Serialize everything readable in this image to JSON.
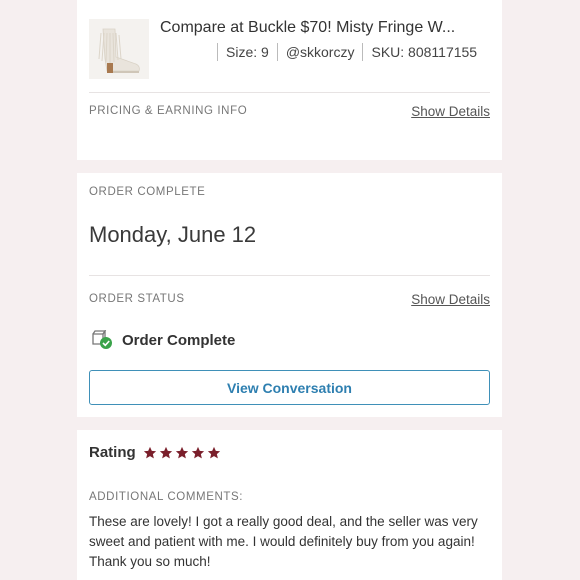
{
  "item": {
    "title": "Compare at Buckle $70! Misty Fringe W...",
    "size": "Size: 9",
    "seller": "@skkorczy",
    "sku": "SKU: 808117155"
  },
  "pricing": {
    "label": "PRICING & EARNING INFO",
    "show_details": "Show Details"
  },
  "order": {
    "complete_label": "ORDER COMPLETE",
    "date": "Monday, June 12",
    "status_label": "ORDER STATUS",
    "show_details": "Show Details",
    "status_text": "Order Complete",
    "status_icon": "box-check-icon",
    "view_conversation": "View Conversation"
  },
  "rating": {
    "label": "Rating",
    "stars": 5,
    "star_color": "#7a1f2b",
    "comments_label": "ADDITIONAL COMMENTS:",
    "comment": "These are lovely! I got a really good deal, and the seller was very sweet and patient with me. I would definitely buy from you again! Thank you so much!"
  },
  "colors": {
    "background": "#f6eff0",
    "accent": "#2e7fb0",
    "success": "#3aa34a"
  }
}
